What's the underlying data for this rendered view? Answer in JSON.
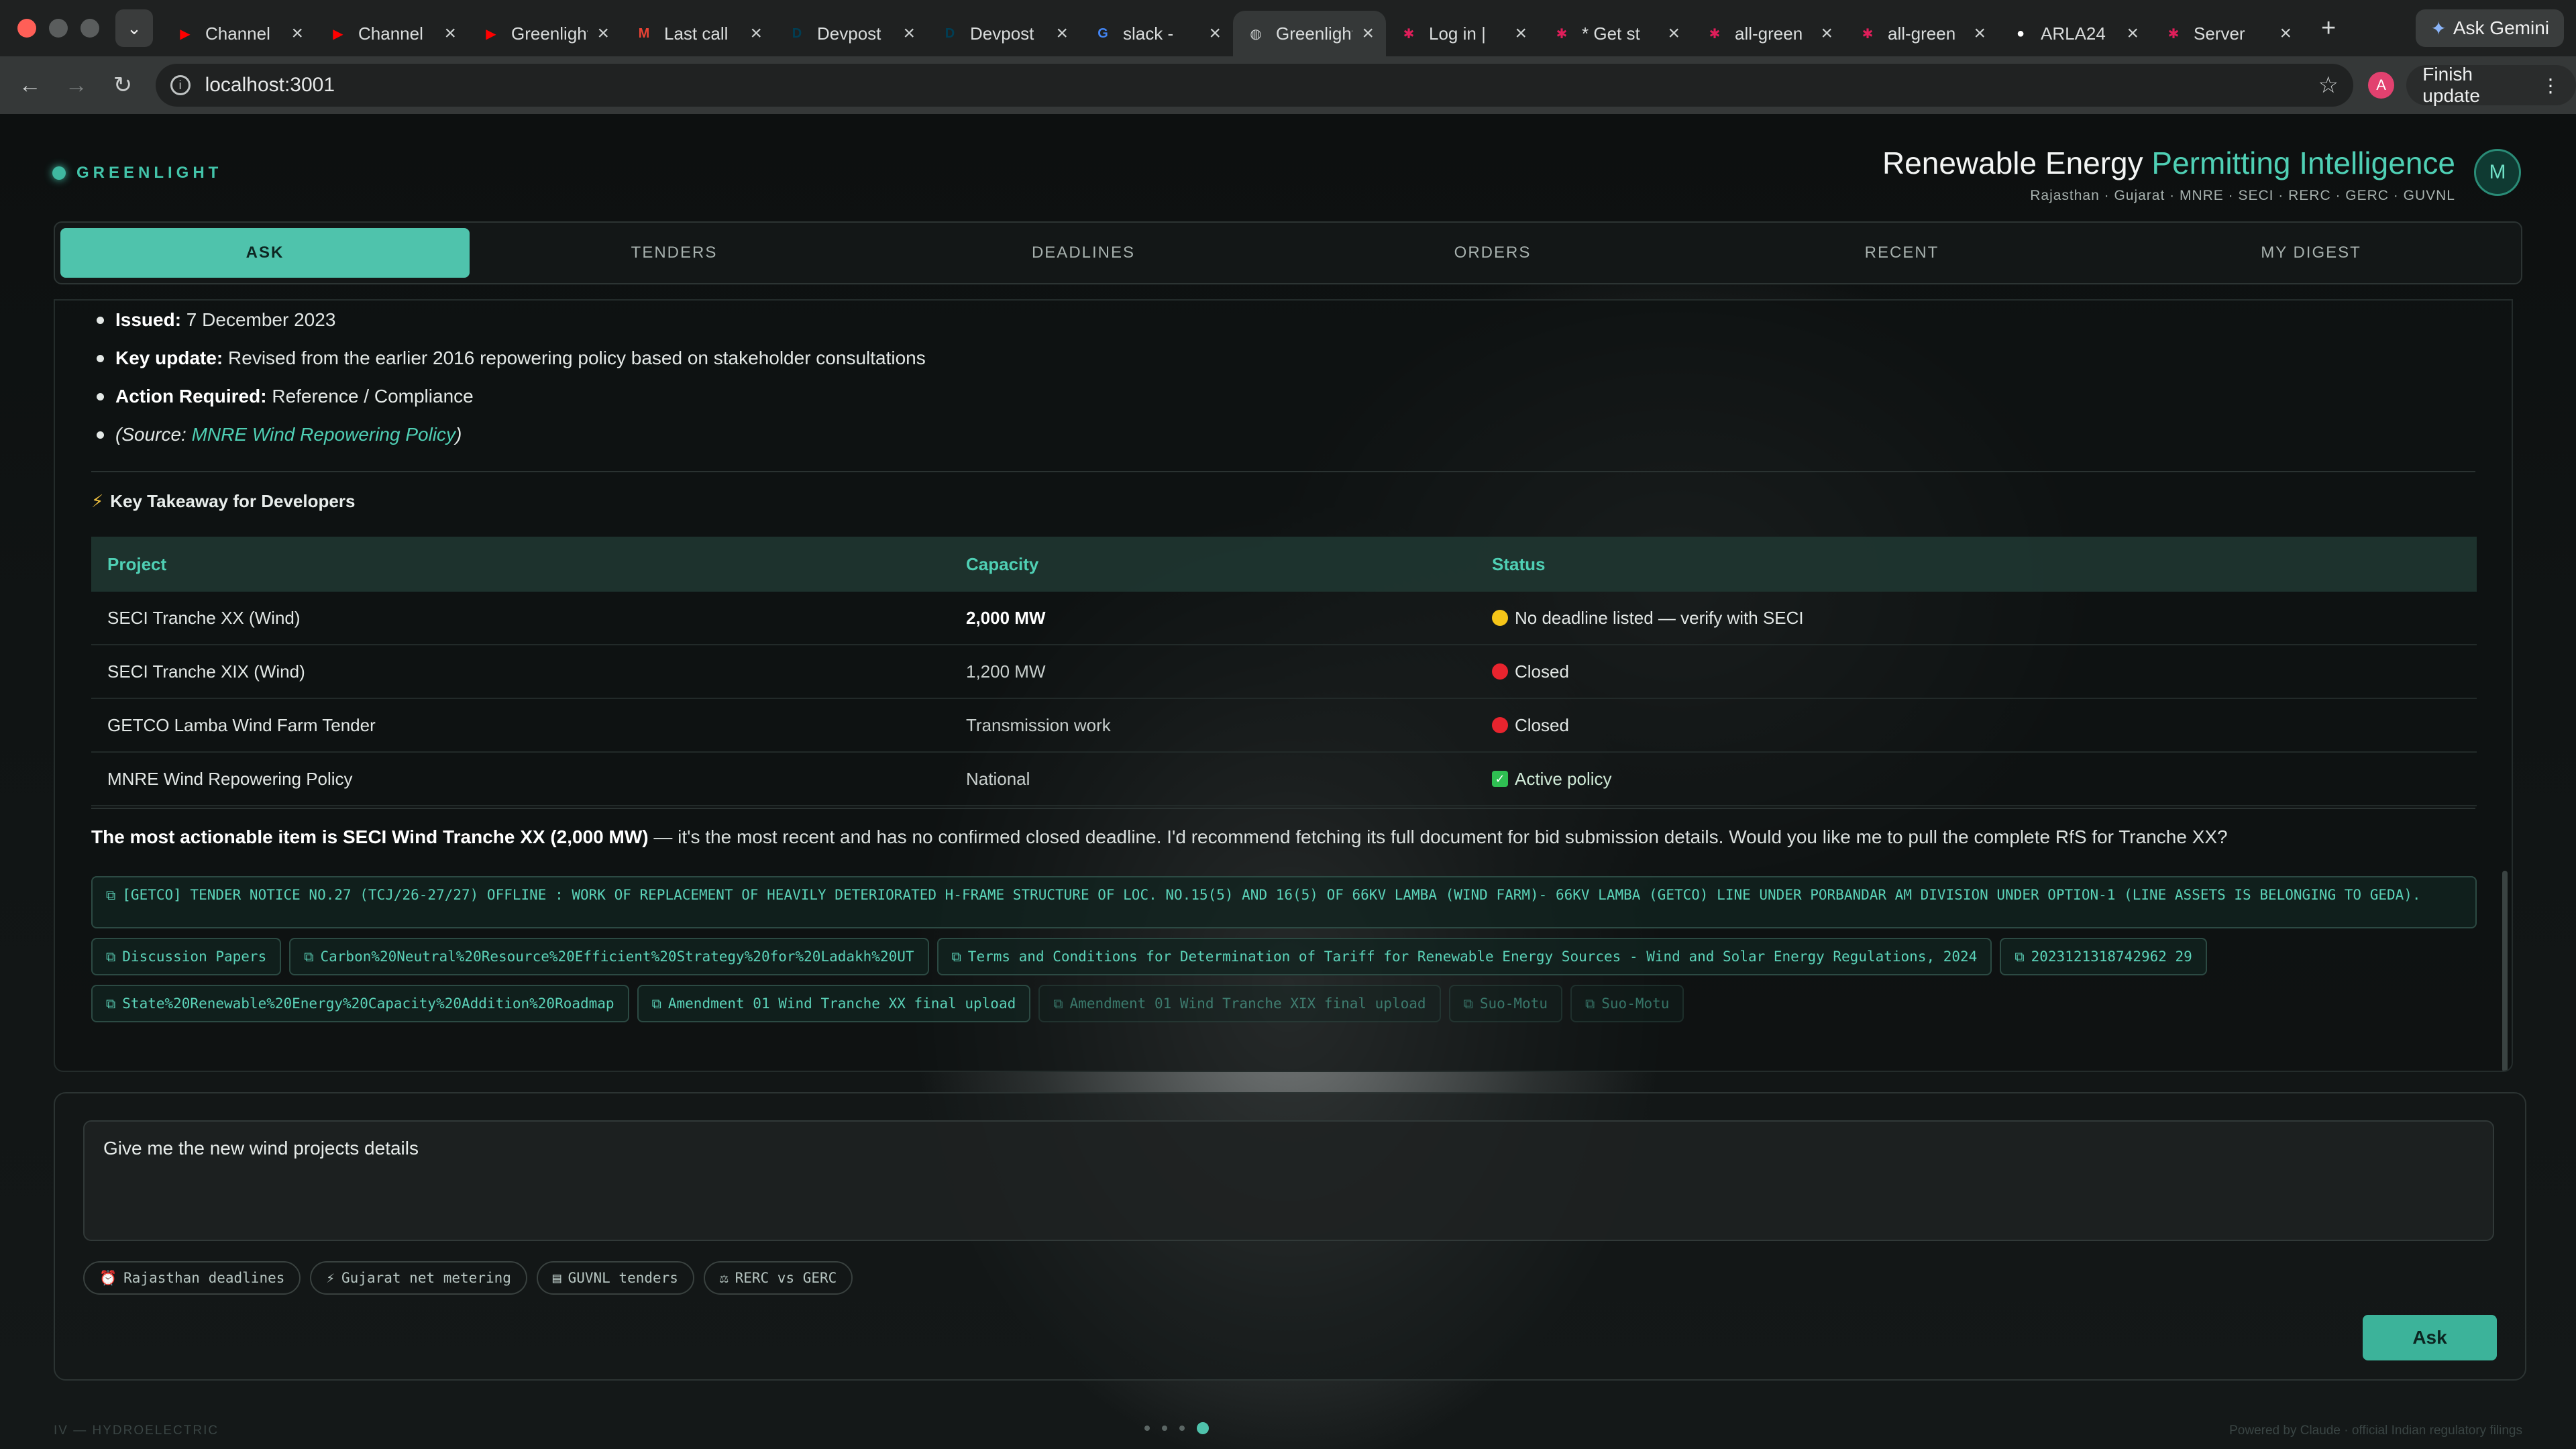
{
  "browser": {
    "tabs": [
      {
        "title": "Channel",
        "icon": "youtube-icon",
        "color": "#ff0000"
      },
      {
        "title": "Channel",
        "icon": "youtube-icon",
        "color": "#ff0000"
      },
      {
        "title": "Greenlight",
        "icon": "youtube-icon",
        "color": "#ff0000"
      },
      {
        "title": "Last call",
        "icon": "gmail-icon",
        "color": "#ea4335"
      },
      {
        "title": "Devpost",
        "icon": "devpost-icon",
        "color": "#003e54"
      },
      {
        "title": "Devpost",
        "icon": "devpost-icon",
        "color": "#003e54"
      },
      {
        "title": "slack -",
        "icon": "google-icon",
        "color": "#4285f4"
      },
      {
        "title": "Greenlight",
        "icon": "globe-icon",
        "color": "#c9cccc"
      },
      {
        "title": "Log in |",
        "icon": "slack-icon",
        "color": "#e01e5a"
      },
      {
        "title": "* Get st",
        "icon": "slack-icon",
        "color": "#e01e5a"
      },
      {
        "title": "all-green",
        "icon": "slack-icon",
        "color": "#e01e5a"
      },
      {
        "title": "all-green",
        "icon": "slack-icon",
        "color": "#e01e5a"
      },
      {
        "title": "ARLA24",
        "icon": "github-icon",
        "color": "#ffffff"
      },
      {
        "title": "Server",
        "icon": "slack-icon",
        "color": "#e01e5a"
      }
    ],
    "active_tab": 7,
    "ask_gemini": "Ask Gemini",
    "url": "localhost:3001",
    "profile_initial": "A",
    "finish_update": "Finish update"
  },
  "app": {
    "brand": "GREENLIGHT",
    "title_prefix": "Renewable Energy ",
    "title_accent": "Permitting Intelligence",
    "subtitle": "Rajasthan · Gujarat · MNRE · SECI · RERC · GERC · GUVNL",
    "avatar": "M",
    "nav": [
      "ASK",
      "TENDERS",
      "DEADLINES",
      "ORDERS",
      "RECENT",
      "MY DIGEST"
    ],
    "active_nav": 0
  },
  "answer": {
    "bullets": [
      {
        "label": "Issued:",
        "text": " 7 December 2023"
      },
      {
        "label": "Key update:",
        "text": " Revised from the earlier 2016 repowering policy based on stakeholder consultations"
      },
      {
        "label": "Action Required:",
        "text": " Reference / Compliance"
      }
    ],
    "source_prefix": "(Source: ",
    "source_link": "MNRE Wind Repowering Policy",
    "source_suffix": ")",
    "takeaway": "Key Takeaway for Developers",
    "table": {
      "headers": [
        "Project",
        "Capacity",
        "Status"
      ],
      "rows": [
        {
          "project": "SECI Tranche XX (Wind)",
          "capacity": "2,000 MW",
          "status": "No deadline listed — verify with SECI",
          "status_icon": "yellow-circle-icon"
        },
        {
          "project": "SECI Tranche XIX (Wind)",
          "capacity": "1,200 MW",
          "status": "Closed",
          "status_icon": "red-circle-icon"
        },
        {
          "project": "GETCO Lamba Wind Farm Tender",
          "capacity": "Transmission work",
          "status": "Closed",
          "status_icon": "red-circle-icon"
        },
        {
          "project": "MNRE Wind Repowering Policy",
          "capacity": "National",
          "status": "Active policy",
          "status_icon": "check-box-icon"
        }
      ]
    },
    "summary_bold": "The most actionable item is SECI Wind Tranche XX (2,000 MW)",
    "summary_rest": " — it's the most recent and has no confirmed closed deadline. I'd recommend fetching its full document for bid submission details. Would you like me to pull the complete RfS for Tranche XX?",
    "sources": [
      "[GETCO] TENDER NOTICE NO.27 (TCJ/26-27/27) OFFLINE : WORK OF REPLACEMENT OF HEAVILY DETERIORATED H-FRAME STRUCTURE OF LOC. NO.15(5) AND 16(5) OF 66KV LAMBA (WIND FARM)- 66KV LAMBA (GETCO) LINE UNDER PORBANDAR AM DIVISION UNDER OPTION-1 (LINE ASSETS IS BELONGING TO GEDA).",
      "Discussion Papers",
      "Carbon%20Neutral%20Resource%20Efficient%20Strategy%20for%20Ladakh%20UT",
      "Terms and Conditions for Determination of Tariff for Renewable Energy Sources - Wind and Solar Energy Regulations, 2024",
      "2023121318742962 29",
      "State%20Renewable%20Energy%20Capacity%20Addition%20Roadmap",
      "Amendment 01 Wind Tranche XX final upload",
      "Amendment 01 Wind Tranche XIX final upload",
      "Suo-Motu",
      "Suo-Motu"
    ]
  },
  "composer": {
    "prompt": "Give me the new wind projects details",
    "suggestions": [
      {
        "icon": "alarm-clock-icon",
        "label": "Rajasthan deadlines"
      },
      {
        "icon": "lightning-icon",
        "label": "Gujarat net metering"
      },
      {
        "icon": "clipboard-icon",
        "label": "GUVNL tenders"
      },
      {
        "icon": "scales-icon",
        "label": "RERC vs GERC"
      }
    ],
    "ask_label": "Ask"
  },
  "footer": {
    "left": "IV — HYDROELECTRIC",
    "right": "Powered by Claude · official Indian regulatory filings"
  },
  "colors": {
    "accent": "#4fc3ac",
    "background": "#0b0d0d"
  }
}
